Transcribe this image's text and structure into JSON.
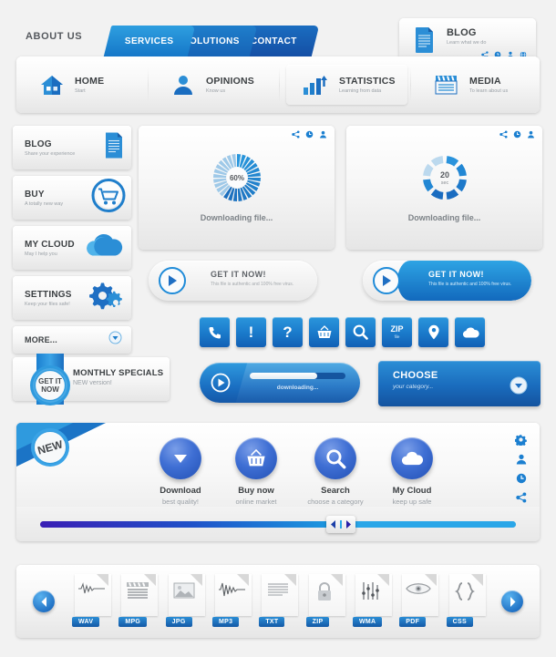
{
  "tabs": {
    "about": "ABOUT US",
    "items": [
      {
        "label": "SERVICES"
      },
      {
        "label": "SOLUTIONS"
      },
      {
        "label": "CONTACT"
      }
    ]
  },
  "blog_card": {
    "title": "BLOG",
    "subtitle": "Learn what we do",
    "icons": [
      "share-icon",
      "clock-icon",
      "user-icon",
      "globe-icon"
    ]
  },
  "mainnav": {
    "items": [
      {
        "title": "HOME",
        "subtitle": "Start",
        "icon": "house-icon",
        "active": false
      },
      {
        "title": "OPINIONS",
        "subtitle": "Know us",
        "icon": "user-icon",
        "active": false
      },
      {
        "title": "STATISTICS",
        "subtitle": "Learning from data",
        "icon": "bar-chart-icon",
        "active": true
      },
      {
        "title": "MEDIA",
        "subtitle": "To learn about us",
        "icon": "clapperboard-icon",
        "active": false
      }
    ]
  },
  "sidebar": {
    "items": [
      {
        "title": "BLOG",
        "subtitle": "Share your experience",
        "icon": "document-icon"
      },
      {
        "title": "BUY",
        "subtitle": "A totally new way",
        "icon": "cart-icon"
      },
      {
        "title": "MY CLOUD",
        "subtitle": "May I help you",
        "icon": "cloud-icon"
      },
      {
        "title": "SETTINGS",
        "subtitle": "Keep your files safe!",
        "icon": "gears-icon"
      }
    ],
    "more_label": "MORE...",
    "more_icon": "chevron-down-icon"
  },
  "specials": {
    "badge_line1": "GET IT",
    "badge_line2": "NOW",
    "title": "MONTHLY SPECIALS",
    "subtitle": "NEW version!"
  },
  "download_panels": [
    {
      "progress_label": "60%",
      "progress_value": 60,
      "caption": "Downloading file...",
      "type": "radial-spinner",
      "icons": [
        "share-icon",
        "clock-icon",
        "user-icon"
      ]
    },
    {
      "progress_label": "20",
      "progress_unit": "sec",
      "progress_value": 75,
      "caption": "Downloading file...",
      "type": "segmented-donut",
      "icons": [
        "share-icon",
        "clock-icon",
        "user-icon"
      ]
    }
  ],
  "get_it_now": {
    "title": "GET IT NOW!",
    "subtitle": "This file is authentic and 100% free virus.",
    "icon": "arrow-right-icon"
  },
  "icon_grid": [
    {
      "name": "phone-icon",
      "glyph": "☎"
    },
    {
      "name": "alert-icon",
      "glyph": "!"
    },
    {
      "name": "help-icon",
      "glyph": "?"
    },
    {
      "name": "basket-icon",
      "glyph": "🛒"
    },
    {
      "name": "search-icon",
      "glyph": "🔍"
    },
    {
      "name": "zip-file-icon",
      "label": "ZIP",
      "sublabel": "file"
    },
    {
      "name": "location-pin-icon",
      "glyph": "📍"
    },
    {
      "name": "cloud-icon",
      "glyph": "☁"
    }
  ],
  "downloading_bar": {
    "label": "downloading...",
    "progress": 70,
    "icon": "play-icon"
  },
  "choose_button": {
    "title": "CHOOSE",
    "subtitle": "your category...",
    "icon": "chevron-down-icon"
  },
  "new_panel": {
    "badge": "NEW",
    "features": [
      {
        "label": "Download",
        "sublabel": "best quality!",
        "icon": "chevron-down-circle-icon"
      },
      {
        "label": "Buy now",
        "sublabel": "online market",
        "icon": "basket-icon"
      },
      {
        "label": "Search",
        "sublabel": "choose a category",
        "icon": "search-icon"
      },
      {
        "label": "My Cloud",
        "sublabel": "keep up safe",
        "icon": "cloud-icon"
      }
    ],
    "side_icons": [
      "gear-icon",
      "user-icon",
      "clock-icon",
      "share-icon"
    ]
  },
  "slider": {
    "value": 62
  },
  "file_bar": {
    "prev_icon": "chevron-left-icon",
    "next_icon": "chevron-right-icon",
    "files": [
      {
        "label": "WAV",
        "glyph": "waveform-icon"
      },
      {
        "label": "MPG",
        "glyph": "clapperboard-icon"
      },
      {
        "label": "JPG",
        "glyph": "image-icon"
      },
      {
        "label": "MP3",
        "glyph": "waveform-icon"
      },
      {
        "label": "TXT",
        "glyph": "text-lines-icon"
      },
      {
        "label": "ZIP",
        "glyph": "lock-icon"
      },
      {
        "label": "WMA",
        "glyph": "equalizer-icon"
      },
      {
        "label": "PDF",
        "glyph": "eye-icon"
      },
      {
        "label": "CSS",
        "glyph": "braces-icon"
      }
    ]
  },
  "colors": {
    "accent": "#1b7fd0",
    "accent_light": "#2fa4e4",
    "accent_dark": "#14539f",
    "text": "#3c4043",
    "muted": "#9aa0a6"
  }
}
